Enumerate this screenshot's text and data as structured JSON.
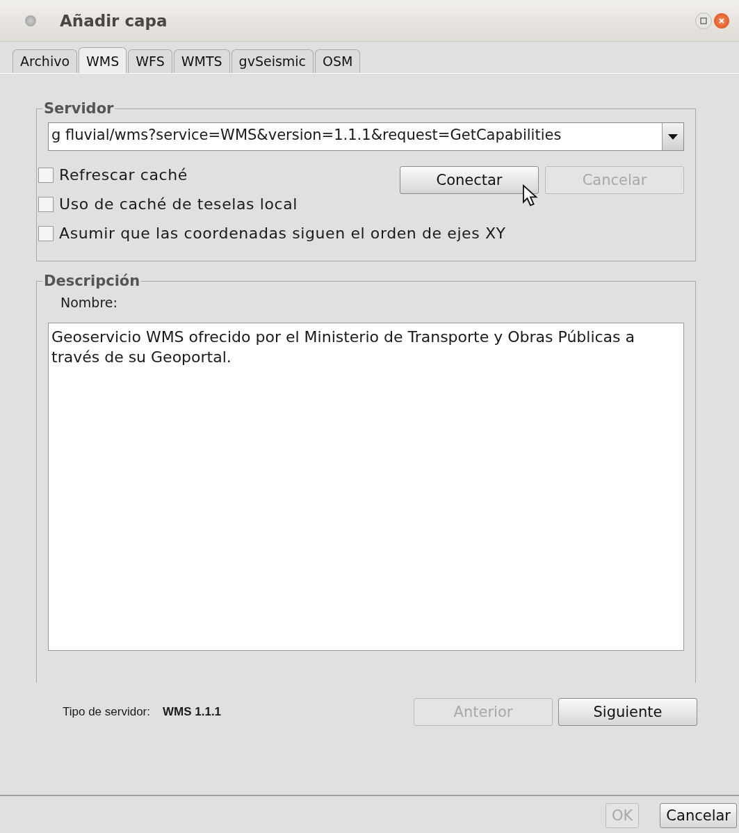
{
  "window": {
    "title": "Añadir capa"
  },
  "tabs": [
    {
      "label": "Archivo",
      "selected": false
    },
    {
      "label": "WMS",
      "selected": true
    },
    {
      "label": "WFS",
      "selected": false
    },
    {
      "label": "WMTS",
      "selected": false
    },
    {
      "label": "gvSeismic",
      "selected": false
    },
    {
      "label": "OSM",
      "selected": false
    }
  ],
  "servidor": {
    "legend": "Servidor",
    "url": "g fluvial/wms?service=WMS&version=1.1.1&request=GetCapabilities",
    "buttons": [
      {
        "label": "Conectar",
        "disabled": false
      },
      {
        "label": "Cancelar",
        "disabled": true
      }
    ],
    "options": [
      {
        "label": "Refrescar caché",
        "checked": false
      },
      {
        "label": "Uso de caché de teselas local",
        "checked": false
      },
      {
        "label": "Asumir que las coordenadas siguen el orden de ejes XY",
        "checked": false
      }
    ]
  },
  "descripcion": {
    "legend": "Descripción",
    "name_label": "Nombre:",
    "text": "Geoservicio WMS ofrecido por el Ministerio de Transporte y Obras Públicas a través de su Geoportal."
  },
  "server_type": {
    "label": "Tipo de servidor:",
    "value": "WMS 1.1.1"
  },
  "nav_buttons": [
    {
      "label": "Anterior",
      "disabled": true
    },
    {
      "label": "Siguiente",
      "disabled": false
    }
  ],
  "footer_buttons": [
    {
      "label": "OK",
      "disabled": true
    },
    {
      "label": "Cancelar",
      "disabled": false
    }
  ]
}
